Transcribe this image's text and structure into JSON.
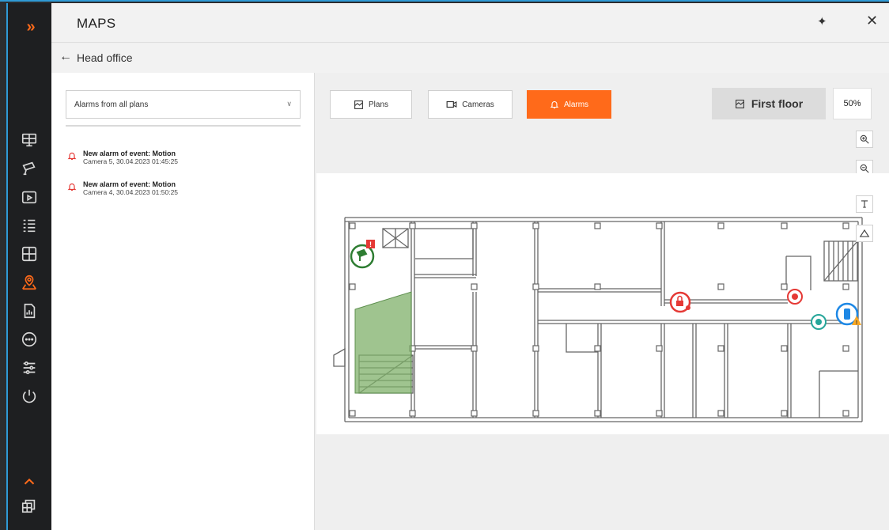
{
  "window": {
    "title": "MAPS",
    "pin_glyph": "✦",
    "close_glyph": "✕"
  },
  "breadcrumb": {
    "back_icon": "arrow-left-icon",
    "text": "Head office"
  },
  "sidebar": {
    "expand_glyph": "»",
    "accent": "#ff6a1a",
    "items": [
      {
        "icon": "monitor-icon"
      },
      {
        "icon": "camera-icon"
      },
      {
        "icon": "archive-icon"
      },
      {
        "icon": "list-icon"
      },
      {
        "icon": "layout-icon"
      },
      {
        "icon": "map-pin-icon",
        "active": true
      },
      {
        "icon": "report-icon"
      },
      {
        "icon": "more-icon"
      },
      {
        "icon": "settings-sliders-icon"
      },
      {
        "icon": "power-icon"
      }
    ],
    "bottom": [
      {
        "icon": "chevron-up-icon"
      },
      {
        "icon": "windows-icon"
      }
    ]
  },
  "alarms_panel": {
    "filter": {
      "selected": "Alarms from all plans"
    },
    "items": [
      {
        "title": "New alarm of event: Motion",
        "subtitle": "Camera 5, 30.04.2023 01:45:25"
      },
      {
        "title": "New alarm of event: Motion",
        "subtitle": "Camera 4, 30.04.2023 01:50:25"
      }
    ]
  },
  "toolbar": {
    "plans_label": "Plans",
    "cameras_label": "Cameras",
    "alarms_label": "Alarms",
    "floor_label": "First floor",
    "zoom": "50%"
  },
  "map_controls": [
    "zoom-in-icon",
    "zoom-out-icon",
    "text-tool-icon",
    "shape-tool-icon"
  ],
  "colors": {
    "accent": "#ff6a1a",
    "alarm": "#e53935",
    "camera_ok": "#2e7d32",
    "sensor_teal": "#26a69a",
    "sensor_blue": "#1e88e5",
    "warning": "#f9a825"
  }
}
